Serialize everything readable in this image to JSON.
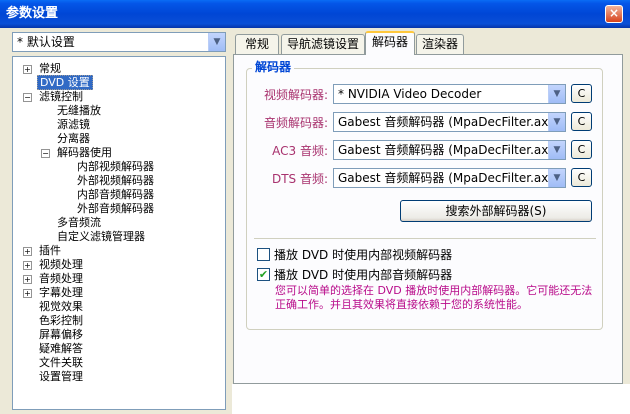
{
  "window": {
    "title": "参数设置",
    "close_glyph": "×"
  },
  "preset": {
    "value": "* 默认设置"
  },
  "tree": {
    "items": [
      {
        "label": "常规",
        "expander": "+"
      },
      {
        "label": "DVD 设置"
      },
      {
        "label": "滤镜控制",
        "expander": "−"
      },
      {
        "label": "无缝播放"
      },
      {
        "label": "源滤镜"
      },
      {
        "label": "分离器"
      },
      {
        "label": "解码器使用",
        "expander": "−"
      },
      {
        "label": "内部视频解码器"
      },
      {
        "label": "外部视频解码器"
      },
      {
        "label": "内部音频解码器"
      },
      {
        "label": "外部音频解码器"
      },
      {
        "label": "多音频流"
      },
      {
        "label": "自定义滤镜管理器"
      },
      {
        "label": "插件",
        "expander": "+"
      },
      {
        "label": "视频处理",
        "expander": "+"
      },
      {
        "label": "音频处理",
        "expander": "+"
      },
      {
        "label": "字幕处理",
        "expander": "+"
      },
      {
        "label": "视觉效果"
      },
      {
        "label": "色彩控制"
      },
      {
        "label": "屏幕偏移"
      },
      {
        "label": "疑难解答"
      },
      {
        "label": "文件关联"
      },
      {
        "label": "设置管理"
      }
    ]
  },
  "tabs": [
    {
      "label": "常规"
    },
    {
      "label": "导航滤镜设置"
    },
    {
      "label": "解码器"
    },
    {
      "label": "渲染器"
    }
  ],
  "decoder": {
    "group_title": "解码器",
    "rows": [
      {
        "label": "视频解码器:",
        "value": "* NVIDIA Video Decoder",
        "button": "C"
      },
      {
        "label": "音频解码器:",
        "value": "Gabest 音频解码器 (MpaDecFilter.ax)",
        "button": "C"
      },
      {
        "label": "AC3 音频:",
        "value": "Gabest 音频解码器 (MpaDecFilter.ax)",
        "button": "C"
      },
      {
        "label": "DTS 音频:",
        "value": "Gabest 音频解码器 (MpaDecFilter.ax)",
        "button": "C"
      }
    ],
    "search_button": "搜索外部解码器(S)",
    "use_internal_video": {
      "label": "播放 DVD 时使用内部视频解码器",
      "checked": false
    },
    "use_internal_audio": {
      "label": "播放 DVD 时使用内部音频解码器",
      "checked": true,
      "check_glyph": "✔"
    },
    "note": "您可以简单的选择在 DVD 播放时使用内部解码器。它可能还无法正确工作。并且其效果将直接依赖于您的系统性能。"
  },
  "colors": {
    "titlebar": "#0046d5",
    "label": "#a8326e",
    "note": "#b80b8a",
    "group_title": "#0046d5"
  }
}
